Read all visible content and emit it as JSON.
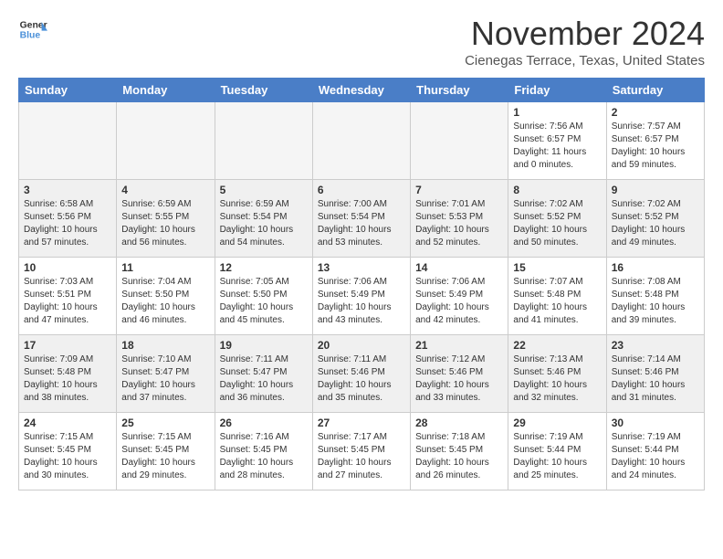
{
  "logo": {
    "line1": "General",
    "line2": "Blue"
  },
  "title": "November 2024",
  "location": "Cienegas Terrace, Texas, United States",
  "weekdays": [
    "Sunday",
    "Monday",
    "Tuesday",
    "Wednesday",
    "Thursday",
    "Friday",
    "Saturday"
  ],
  "weeks": [
    [
      {
        "day": "",
        "info": ""
      },
      {
        "day": "",
        "info": ""
      },
      {
        "day": "",
        "info": ""
      },
      {
        "day": "",
        "info": ""
      },
      {
        "day": "",
        "info": ""
      },
      {
        "day": "1",
        "info": "Sunrise: 7:56 AM\nSunset: 6:57 PM\nDaylight: 11 hours\nand 0 minutes."
      },
      {
        "day": "2",
        "info": "Sunrise: 7:57 AM\nSunset: 6:57 PM\nDaylight: 10 hours\nand 59 minutes."
      }
    ],
    [
      {
        "day": "3",
        "info": "Sunrise: 6:58 AM\nSunset: 5:56 PM\nDaylight: 10 hours\nand 57 minutes."
      },
      {
        "day": "4",
        "info": "Sunrise: 6:59 AM\nSunset: 5:55 PM\nDaylight: 10 hours\nand 56 minutes."
      },
      {
        "day": "5",
        "info": "Sunrise: 6:59 AM\nSunset: 5:54 PM\nDaylight: 10 hours\nand 54 minutes."
      },
      {
        "day": "6",
        "info": "Sunrise: 7:00 AM\nSunset: 5:54 PM\nDaylight: 10 hours\nand 53 minutes."
      },
      {
        "day": "7",
        "info": "Sunrise: 7:01 AM\nSunset: 5:53 PM\nDaylight: 10 hours\nand 52 minutes."
      },
      {
        "day": "8",
        "info": "Sunrise: 7:02 AM\nSunset: 5:52 PM\nDaylight: 10 hours\nand 50 minutes."
      },
      {
        "day": "9",
        "info": "Sunrise: 7:02 AM\nSunset: 5:52 PM\nDaylight: 10 hours\nand 49 minutes."
      }
    ],
    [
      {
        "day": "10",
        "info": "Sunrise: 7:03 AM\nSunset: 5:51 PM\nDaylight: 10 hours\nand 47 minutes."
      },
      {
        "day": "11",
        "info": "Sunrise: 7:04 AM\nSunset: 5:50 PM\nDaylight: 10 hours\nand 46 minutes."
      },
      {
        "day": "12",
        "info": "Sunrise: 7:05 AM\nSunset: 5:50 PM\nDaylight: 10 hours\nand 45 minutes."
      },
      {
        "day": "13",
        "info": "Sunrise: 7:06 AM\nSunset: 5:49 PM\nDaylight: 10 hours\nand 43 minutes."
      },
      {
        "day": "14",
        "info": "Sunrise: 7:06 AM\nSunset: 5:49 PM\nDaylight: 10 hours\nand 42 minutes."
      },
      {
        "day": "15",
        "info": "Sunrise: 7:07 AM\nSunset: 5:48 PM\nDaylight: 10 hours\nand 41 minutes."
      },
      {
        "day": "16",
        "info": "Sunrise: 7:08 AM\nSunset: 5:48 PM\nDaylight: 10 hours\nand 39 minutes."
      }
    ],
    [
      {
        "day": "17",
        "info": "Sunrise: 7:09 AM\nSunset: 5:48 PM\nDaylight: 10 hours\nand 38 minutes."
      },
      {
        "day": "18",
        "info": "Sunrise: 7:10 AM\nSunset: 5:47 PM\nDaylight: 10 hours\nand 37 minutes."
      },
      {
        "day": "19",
        "info": "Sunrise: 7:11 AM\nSunset: 5:47 PM\nDaylight: 10 hours\nand 36 minutes."
      },
      {
        "day": "20",
        "info": "Sunrise: 7:11 AM\nSunset: 5:46 PM\nDaylight: 10 hours\nand 35 minutes."
      },
      {
        "day": "21",
        "info": "Sunrise: 7:12 AM\nSunset: 5:46 PM\nDaylight: 10 hours\nand 33 minutes."
      },
      {
        "day": "22",
        "info": "Sunrise: 7:13 AM\nSunset: 5:46 PM\nDaylight: 10 hours\nand 32 minutes."
      },
      {
        "day": "23",
        "info": "Sunrise: 7:14 AM\nSunset: 5:46 PM\nDaylight: 10 hours\nand 31 minutes."
      }
    ],
    [
      {
        "day": "24",
        "info": "Sunrise: 7:15 AM\nSunset: 5:45 PM\nDaylight: 10 hours\nand 30 minutes."
      },
      {
        "day": "25",
        "info": "Sunrise: 7:15 AM\nSunset: 5:45 PM\nDaylight: 10 hours\nand 29 minutes."
      },
      {
        "day": "26",
        "info": "Sunrise: 7:16 AM\nSunset: 5:45 PM\nDaylight: 10 hours\nand 28 minutes."
      },
      {
        "day": "27",
        "info": "Sunrise: 7:17 AM\nSunset: 5:45 PM\nDaylight: 10 hours\nand 27 minutes."
      },
      {
        "day": "28",
        "info": "Sunrise: 7:18 AM\nSunset: 5:45 PM\nDaylight: 10 hours\nand 26 minutes."
      },
      {
        "day": "29",
        "info": "Sunrise: 7:19 AM\nSunset: 5:44 PM\nDaylight: 10 hours\nand 25 minutes."
      },
      {
        "day": "30",
        "info": "Sunrise: 7:19 AM\nSunset: 5:44 PM\nDaylight: 10 hours\nand 24 minutes."
      }
    ]
  ]
}
